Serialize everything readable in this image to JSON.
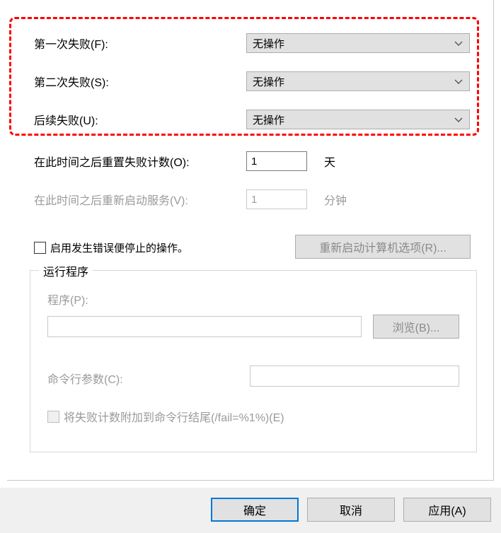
{
  "failures": {
    "first": {
      "label": "第一次失败(F):",
      "value": "无操作"
    },
    "second": {
      "label": "第二次失败(S):",
      "value": "无操作"
    },
    "next": {
      "label": "后续失败(U):",
      "value": "无操作"
    }
  },
  "reset_fail_counter": {
    "label": "在此时间之后重置失败计数(O):",
    "value": "1",
    "unit": "天"
  },
  "restart_service": {
    "label": "在此时间之后重新启动服务(V):",
    "value": "1",
    "unit": "分钟"
  },
  "stop_on_error": {
    "label": "启用发生错误便停止的操作。"
  },
  "restart_options_btn": "重新启动计算机选项(R)...",
  "run_program": {
    "legend": "运行程序",
    "program_label": "程序(P):",
    "browse": "浏览(B)...",
    "cmdline_label": "命令行参数(C):",
    "append_fail_label": "将失败计数附加到命令行结尾(/fail=%1%)(E)"
  },
  "buttons": {
    "ok": "确定",
    "cancel": "取消",
    "apply": "应用(A)"
  }
}
